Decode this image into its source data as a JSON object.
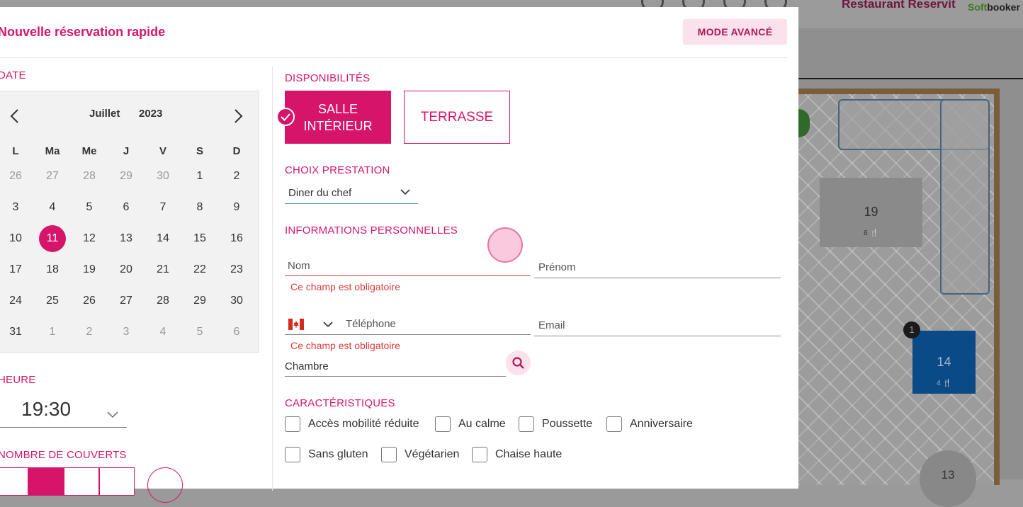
{
  "background": {
    "brand_title": "Restaurant Reservit",
    "logo_prefix": "Soft",
    "logo_suffix": "booker",
    "tables": [
      {
        "number": "19",
        "capacity": "6"
      },
      {
        "number": "14",
        "capacity": "4"
      },
      {
        "number": "13"
      }
    ],
    "badge": "1"
  },
  "modal": {
    "title": "Nouvelle réservation rapide",
    "mode_button": "MODE AVANCÉ",
    "date_label": "DATE",
    "calendar": {
      "month": "Juillet",
      "year": "2023",
      "weekdays": [
        "L",
        "Ma",
        "Me",
        "J",
        "V",
        "S",
        "D"
      ],
      "weeks": [
        [
          "26",
          "27",
          "28",
          "29",
          "30",
          "1",
          "2"
        ],
        [
          "3",
          "4",
          "5",
          "6",
          "7",
          "8",
          "9"
        ],
        [
          "10",
          "11",
          "12",
          "13",
          "14",
          "15",
          "16"
        ],
        [
          "17",
          "18",
          "19",
          "20",
          "21",
          "22",
          "23"
        ],
        [
          "24",
          "25",
          "26",
          "27",
          "28",
          "29",
          "30"
        ],
        [
          "31",
          "1",
          "2",
          "3",
          "4",
          "5",
          "6"
        ]
      ],
      "selected_day": "11"
    },
    "hour_label": "HEURE",
    "hour_value": "19:30",
    "covers_label": "NOMBRE DE COUVERTS",
    "availability_label": "DISPONIBILITÉS",
    "areas": [
      {
        "label": "SALLE INTÉRIEUR",
        "selected": true
      },
      {
        "label": "TERRASSE",
        "selected": false
      }
    ],
    "service_label": "CHOIX PRESTATION",
    "service_value": "Diner du chef",
    "personal_label": "INFORMATIONS PERSONNELLES",
    "fields": {
      "last_name": "Nom",
      "first_name": "Prénom",
      "phone": "Téléphone",
      "email": "Email",
      "room": "Chambre"
    },
    "required_error": "Ce champ est obligatoire",
    "characteristics_label": "CARACTÉRISTIQUES",
    "characteristics": [
      "Accès mobilité réduite",
      "Au calme",
      "Poussette",
      "Anniversaire",
      "Sans gluten",
      "Végétarien",
      "Chaise haute"
    ],
    "colors": {
      "accent": "#d6156a",
      "accent_light": "#fbe1ec",
      "error": "#d93a3a"
    }
  }
}
